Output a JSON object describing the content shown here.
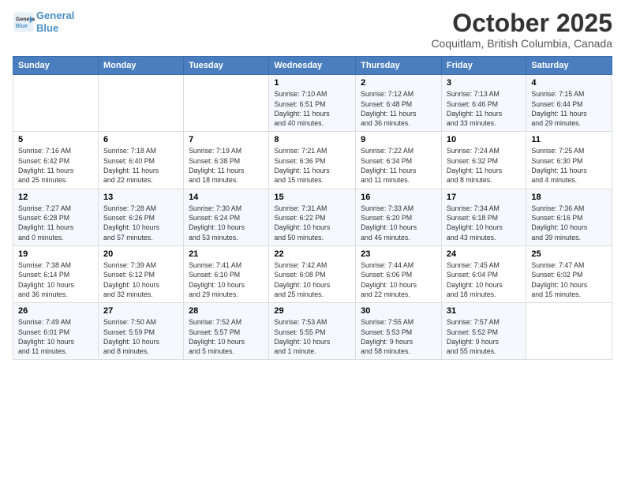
{
  "logo": {
    "line1": "General",
    "line2": "Blue"
  },
  "title": "October 2025",
  "subtitle": "Coquitlam, British Columbia, Canada",
  "headers": [
    "Sunday",
    "Monday",
    "Tuesday",
    "Wednesday",
    "Thursday",
    "Friday",
    "Saturday"
  ],
  "weeks": [
    [
      {
        "day": "",
        "info": ""
      },
      {
        "day": "",
        "info": ""
      },
      {
        "day": "",
        "info": ""
      },
      {
        "day": "1",
        "info": "Sunrise: 7:10 AM\nSunset: 6:51 PM\nDaylight: 11 hours\nand 40 minutes."
      },
      {
        "day": "2",
        "info": "Sunrise: 7:12 AM\nSunset: 6:48 PM\nDaylight: 11 hours\nand 36 minutes."
      },
      {
        "day": "3",
        "info": "Sunrise: 7:13 AM\nSunset: 6:46 PM\nDaylight: 11 hours\nand 33 minutes."
      },
      {
        "day": "4",
        "info": "Sunrise: 7:15 AM\nSunset: 6:44 PM\nDaylight: 11 hours\nand 29 minutes."
      }
    ],
    [
      {
        "day": "5",
        "info": "Sunrise: 7:16 AM\nSunset: 6:42 PM\nDaylight: 11 hours\nand 25 minutes."
      },
      {
        "day": "6",
        "info": "Sunrise: 7:18 AM\nSunset: 6:40 PM\nDaylight: 11 hours\nand 22 minutes."
      },
      {
        "day": "7",
        "info": "Sunrise: 7:19 AM\nSunset: 6:38 PM\nDaylight: 11 hours\nand 18 minutes."
      },
      {
        "day": "8",
        "info": "Sunrise: 7:21 AM\nSunset: 6:36 PM\nDaylight: 11 hours\nand 15 minutes."
      },
      {
        "day": "9",
        "info": "Sunrise: 7:22 AM\nSunset: 6:34 PM\nDaylight: 11 hours\nand 11 minutes."
      },
      {
        "day": "10",
        "info": "Sunrise: 7:24 AM\nSunset: 6:32 PM\nDaylight: 11 hours\nand 8 minutes."
      },
      {
        "day": "11",
        "info": "Sunrise: 7:25 AM\nSunset: 6:30 PM\nDaylight: 11 hours\nand 4 minutes."
      }
    ],
    [
      {
        "day": "12",
        "info": "Sunrise: 7:27 AM\nSunset: 6:28 PM\nDaylight: 11 hours\nand 0 minutes."
      },
      {
        "day": "13",
        "info": "Sunrise: 7:28 AM\nSunset: 6:26 PM\nDaylight: 10 hours\nand 57 minutes."
      },
      {
        "day": "14",
        "info": "Sunrise: 7:30 AM\nSunset: 6:24 PM\nDaylight: 10 hours\nand 53 minutes."
      },
      {
        "day": "15",
        "info": "Sunrise: 7:31 AM\nSunset: 6:22 PM\nDaylight: 10 hours\nand 50 minutes."
      },
      {
        "day": "16",
        "info": "Sunrise: 7:33 AM\nSunset: 6:20 PM\nDaylight: 10 hours\nand 46 minutes."
      },
      {
        "day": "17",
        "info": "Sunrise: 7:34 AM\nSunset: 6:18 PM\nDaylight: 10 hours\nand 43 minutes."
      },
      {
        "day": "18",
        "info": "Sunrise: 7:36 AM\nSunset: 6:16 PM\nDaylight: 10 hours\nand 39 minutes."
      }
    ],
    [
      {
        "day": "19",
        "info": "Sunrise: 7:38 AM\nSunset: 6:14 PM\nDaylight: 10 hours\nand 36 minutes."
      },
      {
        "day": "20",
        "info": "Sunrise: 7:39 AM\nSunset: 6:12 PM\nDaylight: 10 hours\nand 32 minutes."
      },
      {
        "day": "21",
        "info": "Sunrise: 7:41 AM\nSunset: 6:10 PM\nDaylight: 10 hours\nand 29 minutes."
      },
      {
        "day": "22",
        "info": "Sunrise: 7:42 AM\nSunset: 6:08 PM\nDaylight: 10 hours\nand 25 minutes."
      },
      {
        "day": "23",
        "info": "Sunrise: 7:44 AM\nSunset: 6:06 PM\nDaylight: 10 hours\nand 22 minutes."
      },
      {
        "day": "24",
        "info": "Sunrise: 7:45 AM\nSunset: 6:04 PM\nDaylight: 10 hours\nand 18 minutes."
      },
      {
        "day": "25",
        "info": "Sunrise: 7:47 AM\nSunset: 6:02 PM\nDaylight: 10 hours\nand 15 minutes."
      }
    ],
    [
      {
        "day": "26",
        "info": "Sunrise: 7:49 AM\nSunset: 6:01 PM\nDaylight: 10 hours\nand 11 minutes."
      },
      {
        "day": "27",
        "info": "Sunrise: 7:50 AM\nSunset: 5:59 PM\nDaylight: 10 hours\nand 8 minutes."
      },
      {
        "day": "28",
        "info": "Sunrise: 7:52 AM\nSunset: 5:57 PM\nDaylight: 10 hours\nand 5 minutes."
      },
      {
        "day": "29",
        "info": "Sunrise: 7:53 AM\nSunset: 5:55 PM\nDaylight: 10 hours\nand 1 minute."
      },
      {
        "day": "30",
        "info": "Sunrise: 7:55 AM\nSunset: 5:53 PM\nDaylight: 9 hours\nand 58 minutes."
      },
      {
        "day": "31",
        "info": "Sunrise: 7:57 AM\nSunset: 5:52 PM\nDaylight: 9 hours\nand 55 minutes."
      },
      {
        "day": "",
        "info": ""
      }
    ]
  ]
}
